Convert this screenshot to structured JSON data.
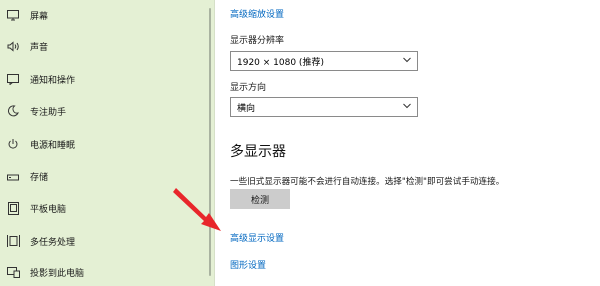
{
  "sidebar": {
    "items": [
      {
        "label": "屏幕",
        "icon": "monitor-icon"
      },
      {
        "label": "声音",
        "icon": "speaker-icon"
      },
      {
        "label": "通知和操作",
        "icon": "notification-icon"
      },
      {
        "label": "专注助手",
        "icon": "moon-icon"
      },
      {
        "label": "电源和睡眠",
        "icon": "power-icon"
      },
      {
        "label": "存储",
        "icon": "storage-icon"
      },
      {
        "label": "平板电脑",
        "icon": "tablet-icon"
      },
      {
        "label": "多任务处理",
        "icon": "multitasking-icon"
      },
      {
        "label": "投影到此电脑",
        "icon": "projector-icon"
      }
    ]
  },
  "main": {
    "advanced_scaling_link": "高级缩放设置",
    "resolution_label": "显示器分辨率",
    "resolution_value": "1920 × 1080 (推荐)",
    "orientation_label": "显示方向",
    "orientation_value": "横向",
    "multi_display_title": "多显示器",
    "multi_display_desc": "一些旧式显示器可能不会进行自动连接。选择\"检测\"即可尝试手动连接。",
    "detect_button": "检测",
    "advanced_display_link": "高级显示设置",
    "graphics_link": "图形设置"
  },
  "colors": {
    "sidebar_bg": "#e4f0d4",
    "link": "#0067c0",
    "button_bg": "#cccccc",
    "arrow": "#e8262b"
  }
}
